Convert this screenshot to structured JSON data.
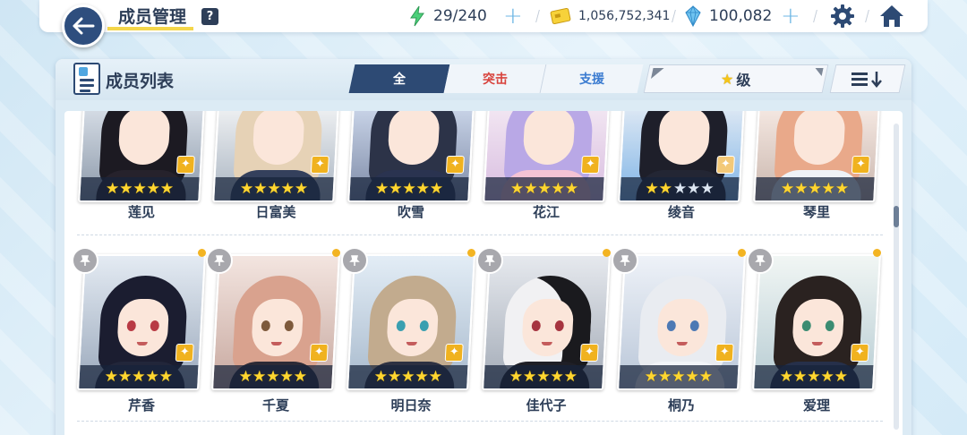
{
  "topbar": {
    "title": "成员管理",
    "help_label": "?",
    "ap": "29/240",
    "credits": "1,056,752,341",
    "gems": "100,082"
  },
  "panel": {
    "title": "成员列表",
    "tabs": [
      {
        "label": "全",
        "active": true
      },
      {
        "label": "突击",
        "active": false,
        "color": "#d8433d"
      },
      {
        "label": "支援",
        "active": false,
        "color": "#3a7bd0"
      }
    ],
    "sort_label": "级"
  },
  "colors": {
    "navy": "#2d4a74",
    "star": "#ffd630",
    "badge": "#f0b21f",
    "dot": "#f3b422"
  },
  "students_row1": [
    {
      "name": "莲见",
      "stars": 5
    },
    {
      "name": "日富美",
      "stars": 5
    },
    {
      "name": "吹雪",
      "stars": 5
    },
    {
      "name": "花江",
      "stars": 5
    },
    {
      "name": "绫音",
      "stars": 2
    },
    {
      "name": "琴里",
      "stars": 5
    }
  ],
  "students_row2": [
    {
      "name": "芹香",
      "stars": 5
    },
    {
      "name": "千夏",
      "stars": 5
    },
    {
      "name": "明日奈",
      "stars": 5
    },
    {
      "name": "佳代子",
      "stars": 5
    },
    {
      "name": "桐乃",
      "stars": 5
    },
    {
      "name": "爱理",
      "stars": 5
    }
  ]
}
